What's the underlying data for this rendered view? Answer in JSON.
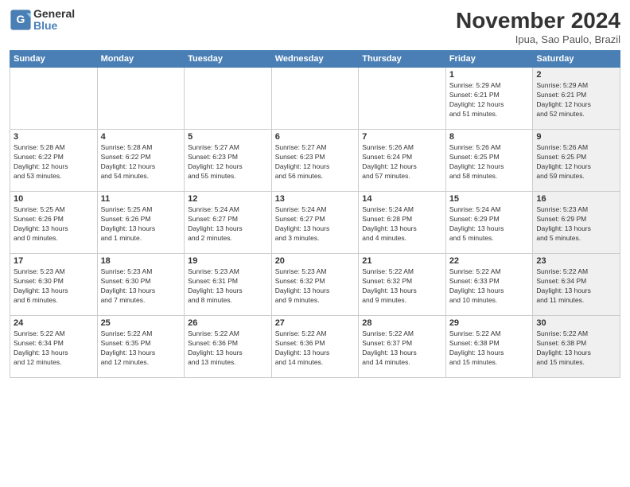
{
  "logo": {
    "general": "General",
    "blue": "Blue"
  },
  "title": "November 2024",
  "location": "Ipua, Sao Paulo, Brazil",
  "days_of_week": [
    "Sunday",
    "Monday",
    "Tuesday",
    "Wednesday",
    "Thursday",
    "Friday",
    "Saturday"
  ],
  "weeks": [
    [
      {
        "day": "",
        "info": "",
        "shaded": false
      },
      {
        "day": "",
        "info": "",
        "shaded": false
      },
      {
        "day": "",
        "info": "",
        "shaded": false
      },
      {
        "day": "",
        "info": "",
        "shaded": false
      },
      {
        "day": "",
        "info": "",
        "shaded": false
      },
      {
        "day": "1",
        "info": "Sunrise: 5:29 AM\nSunset: 6:21 PM\nDaylight: 12 hours\nand 51 minutes.",
        "shaded": false
      },
      {
        "day": "2",
        "info": "Sunrise: 5:29 AM\nSunset: 6:21 PM\nDaylight: 12 hours\nand 52 minutes.",
        "shaded": true
      }
    ],
    [
      {
        "day": "3",
        "info": "Sunrise: 5:28 AM\nSunset: 6:22 PM\nDaylight: 12 hours\nand 53 minutes.",
        "shaded": false
      },
      {
        "day": "4",
        "info": "Sunrise: 5:28 AM\nSunset: 6:22 PM\nDaylight: 12 hours\nand 54 minutes.",
        "shaded": false
      },
      {
        "day": "5",
        "info": "Sunrise: 5:27 AM\nSunset: 6:23 PM\nDaylight: 12 hours\nand 55 minutes.",
        "shaded": false
      },
      {
        "day": "6",
        "info": "Sunrise: 5:27 AM\nSunset: 6:23 PM\nDaylight: 12 hours\nand 56 minutes.",
        "shaded": false
      },
      {
        "day": "7",
        "info": "Sunrise: 5:26 AM\nSunset: 6:24 PM\nDaylight: 12 hours\nand 57 minutes.",
        "shaded": false
      },
      {
        "day": "8",
        "info": "Sunrise: 5:26 AM\nSunset: 6:25 PM\nDaylight: 12 hours\nand 58 minutes.",
        "shaded": false
      },
      {
        "day": "9",
        "info": "Sunrise: 5:26 AM\nSunset: 6:25 PM\nDaylight: 12 hours\nand 59 minutes.",
        "shaded": true
      }
    ],
    [
      {
        "day": "10",
        "info": "Sunrise: 5:25 AM\nSunset: 6:26 PM\nDaylight: 13 hours\nand 0 minutes.",
        "shaded": false
      },
      {
        "day": "11",
        "info": "Sunrise: 5:25 AM\nSunset: 6:26 PM\nDaylight: 13 hours\nand 1 minute.",
        "shaded": false
      },
      {
        "day": "12",
        "info": "Sunrise: 5:24 AM\nSunset: 6:27 PM\nDaylight: 13 hours\nand 2 minutes.",
        "shaded": false
      },
      {
        "day": "13",
        "info": "Sunrise: 5:24 AM\nSunset: 6:27 PM\nDaylight: 13 hours\nand 3 minutes.",
        "shaded": false
      },
      {
        "day": "14",
        "info": "Sunrise: 5:24 AM\nSunset: 6:28 PM\nDaylight: 13 hours\nand 4 minutes.",
        "shaded": false
      },
      {
        "day": "15",
        "info": "Sunrise: 5:24 AM\nSunset: 6:29 PM\nDaylight: 13 hours\nand 5 minutes.",
        "shaded": false
      },
      {
        "day": "16",
        "info": "Sunrise: 5:23 AM\nSunset: 6:29 PM\nDaylight: 13 hours\nand 5 minutes.",
        "shaded": true
      }
    ],
    [
      {
        "day": "17",
        "info": "Sunrise: 5:23 AM\nSunset: 6:30 PM\nDaylight: 13 hours\nand 6 minutes.",
        "shaded": false
      },
      {
        "day": "18",
        "info": "Sunrise: 5:23 AM\nSunset: 6:30 PM\nDaylight: 13 hours\nand 7 minutes.",
        "shaded": false
      },
      {
        "day": "19",
        "info": "Sunrise: 5:23 AM\nSunset: 6:31 PM\nDaylight: 13 hours\nand 8 minutes.",
        "shaded": false
      },
      {
        "day": "20",
        "info": "Sunrise: 5:23 AM\nSunset: 6:32 PM\nDaylight: 13 hours\nand 9 minutes.",
        "shaded": false
      },
      {
        "day": "21",
        "info": "Sunrise: 5:22 AM\nSunset: 6:32 PM\nDaylight: 13 hours\nand 9 minutes.",
        "shaded": false
      },
      {
        "day": "22",
        "info": "Sunrise: 5:22 AM\nSunset: 6:33 PM\nDaylight: 13 hours\nand 10 minutes.",
        "shaded": false
      },
      {
        "day": "23",
        "info": "Sunrise: 5:22 AM\nSunset: 6:34 PM\nDaylight: 13 hours\nand 11 minutes.",
        "shaded": true
      }
    ],
    [
      {
        "day": "24",
        "info": "Sunrise: 5:22 AM\nSunset: 6:34 PM\nDaylight: 13 hours\nand 12 minutes.",
        "shaded": false
      },
      {
        "day": "25",
        "info": "Sunrise: 5:22 AM\nSunset: 6:35 PM\nDaylight: 13 hours\nand 12 minutes.",
        "shaded": false
      },
      {
        "day": "26",
        "info": "Sunrise: 5:22 AM\nSunset: 6:36 PM\nDaylight: 13 hours\nand 13 minutes.",
        "shaded": false
      },
      {
        "day": "27",
        "info": "Sunrise: 5:22 AM\nSunset: 6:36 PM\nDaylight: 13 hours\nand 14 minutes.",
        "shaded": false
      },
      {
        "day": "28",
        "info": "Sunrise: 5:22 AM\nSunset: 6:37 PM\nDaylight: 13 hours\nand 14 minutes.",
        "shaded": false
      },
      {
        "day": "29",
        "info": "Sunrise: 5:22 AM\nSunset: 6:38 PM\nDaylight: 13 hours\nand 15 minutes.",
        "shaded": false
      },
      {
        "day": "30",
        "info": "Sunrise: 5:22 AM\nSunset: 6:38 PM\nDaylight: 13 hours\nand 15 minutes.",
        "shaded": true
      }
    ]
  ]
}
